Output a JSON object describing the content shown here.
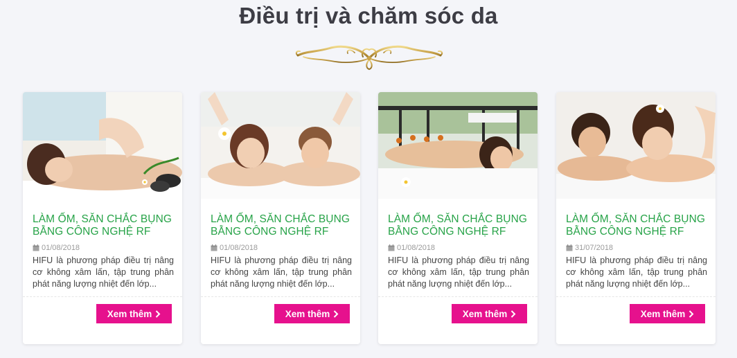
{
  "section": {
    "title": "Điều trị và chăm sóc da"
  },
  "cards": [
    {
      "title": "LÀM ỐM, SĂN CHẮC BỤNG BẰNG CÔNG NGHỆ RF",
      "date": "01/08/2018",
      "excerpt": "HIFU là phương pháp điều trị nâng cơ không xâm lấn, tập trung phân phát năng lượng nhiệt đến lớp...",
      "button": "Xem thêm"
    },
    {
      "title": "LÀM ỐM, SĂN CHẮC BỤNG BẰNG CÔNG NGHỆ RF",
      "date": "01/08/2018",
      "excerpt": "HIFU là phương pháp điều trị nâng cơ không xâm lấn, tập trung phân phát năng lượng nhiệt đến lớp...",
      "button": "Xem thêm"
    },
    {
      "title": "LÀM ỐM, SĂN CHẮC BỤNG BẰNG CÔNG NGHỆ RF",
      "date": "01/08/2018",
      "excerpt": "HIFU là phương pháp điều trị nâng cơ không xâm lấn, tập trung phân phát năng lượng nhiệt đến lớp...",
      "button": "Xem thêm"
    },
    {
      "title": "LÀM ỐM, SĂN CHẮC BỤNG BẰNG CÔNG NGHỆ RF",
      "date": "31/07/2018",
      "excerpt": "HIFU là phương pháp điều trị nâng cơ không xâm lấn, tập trung phân phát năng lượng nhiệt đến lớp...",
      "button": "Xem thêm"
    }
  ],
  "colors": {
    "title_text": "#3d3d45",
    "card_title": "#27a348",
    "button_bg": "#e6118d",
    "ornament": "#c9a34a"
  },
  "icons": {
    "ornament": "gold-flourish-divider",
    "date": "calendar-icon",
    "button": "chevron-right-icon"
  }
}
